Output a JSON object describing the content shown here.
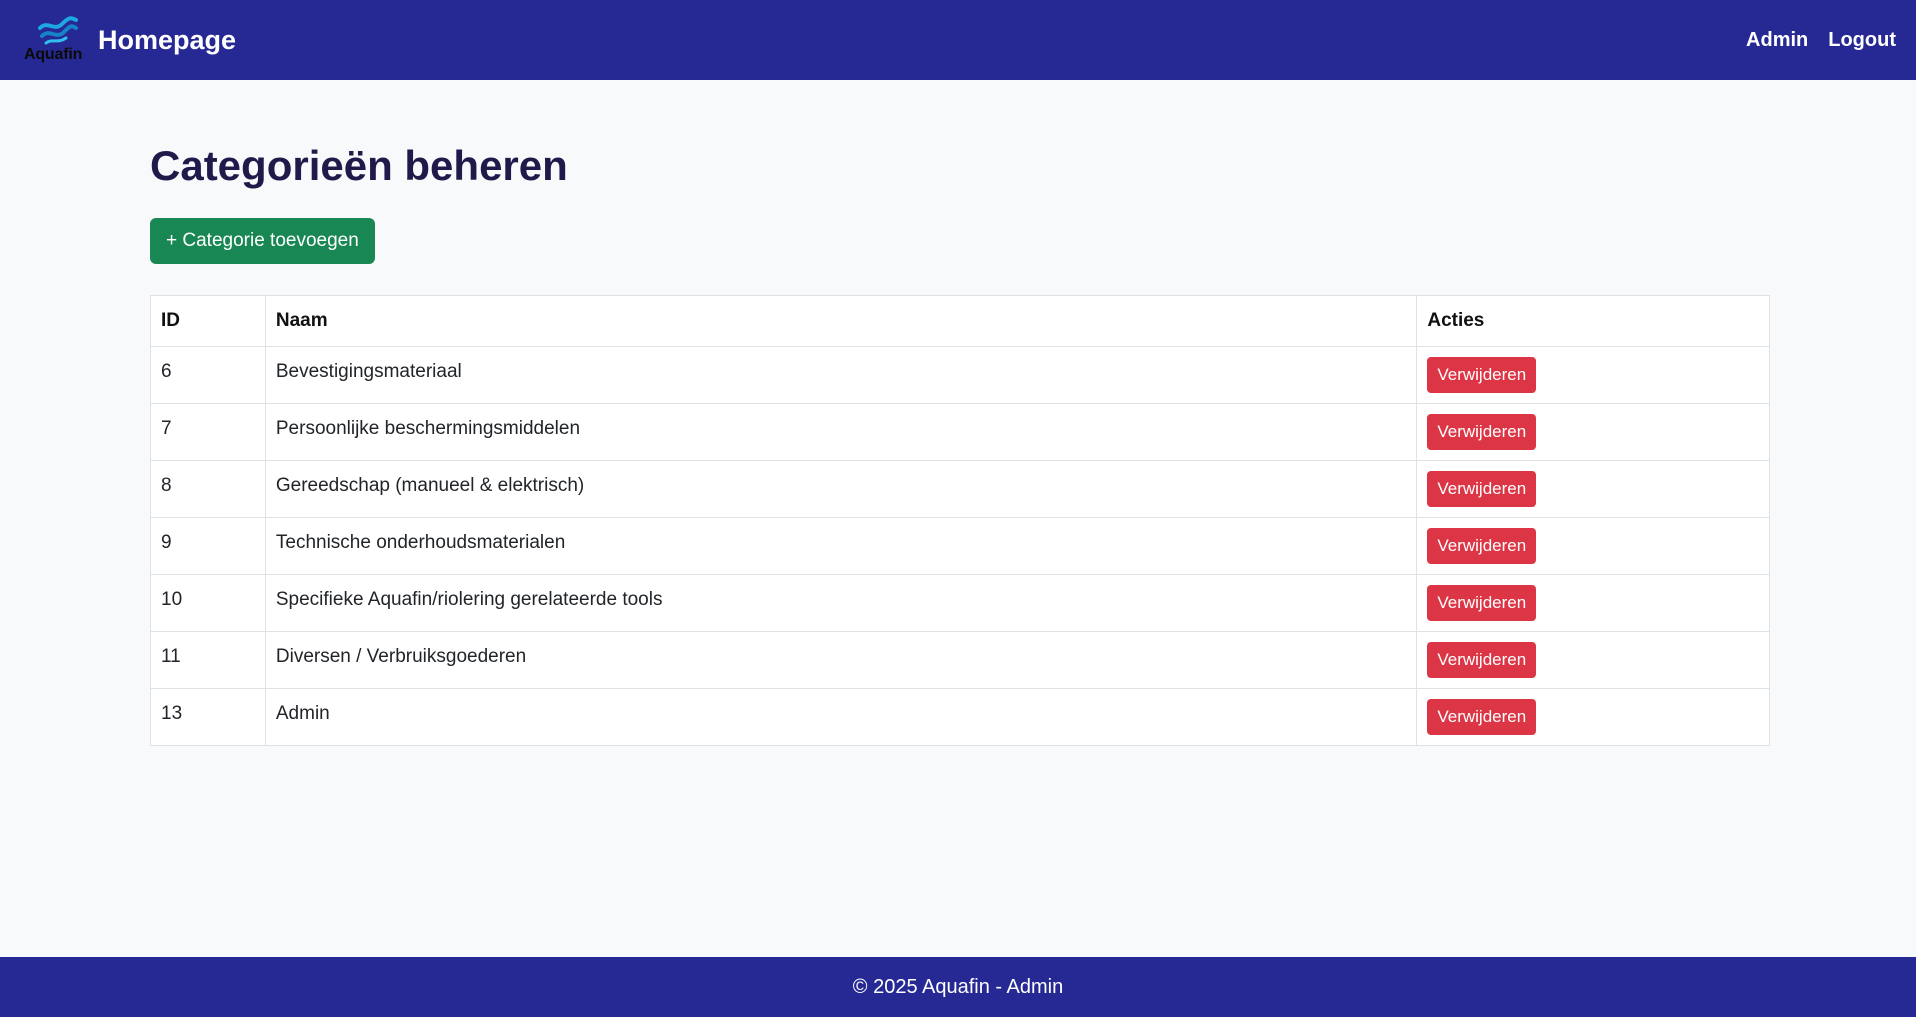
{
  "navbar": {
    "logo_text": "Aquafin",
    "title": "Homepage",
    "links": [
      {
        "label": "Admin"
      },
      {
        "label": "Logout"
      }
    ]
  },
  "page": {
    "heading": "Categorieën beheren",
    "add_button_label": "+ Categorie toevoegen"
  },
  "table": {
    "headers": [
      "ID",
      "Naam",
      "Acties"
    ],
    "delete_label": "Verwijderen",
    "rows": [
      {
        "id": "6",
        "naam": "Bevestigingsmateriaal"
      },
      {
        "id": "7",
        "naam": "Persoonlijke beschermingsmiddelen"
      },
      {
        "id": "8",
        "naam": "Gereedschap (manueel & elektrisch)"
      },
      {
        "id": "9",
        "naam": "Technische onderhoudsmaterialen"
      },
      {
        "id": "10",
        "naam": "Specifieke Aquafin/riolering gerelateerde tools"
      },
      {
        "id": "11",
        "naam": "Diversen / Verbruiksgoederen"
      },
      {
        "id": "13",
        "naam": "Admin"
      }
    ]
  },
  "footer": {
    "text": "© 2025 Aquafin - Admin"
  },
  "colors": {
    "navbar": "#262893",
    "success": "#198754",
    "danger": "#dc3545",
    "heading": "#1e1b4b",
    "background": "#f8f9fa"
  },
  "icons": {
    "logo": "aquafin-waves-logo"
  }
}
